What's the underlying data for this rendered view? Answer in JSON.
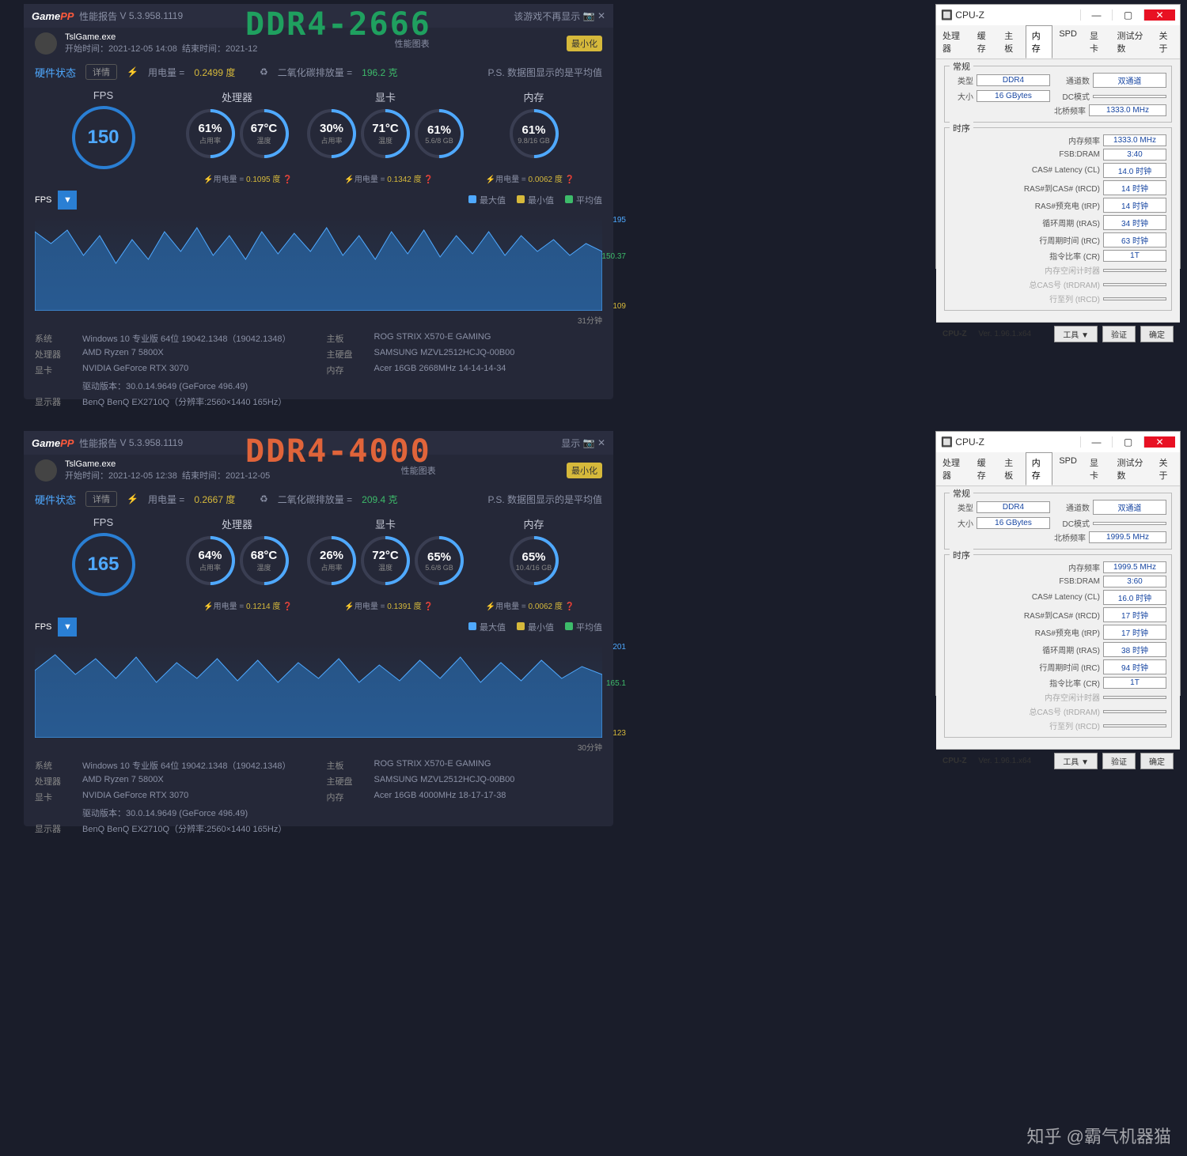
{
  "overlay": {
    "title1": "DDR4-2666",
    "title2": "DDR4-4000"
  },
  "watermark": "知乎 @霸气机器猫",
  "gamepp": {
    "brand": "Game",
    "brand2": "PP",
    "report": "性能报告",
    "version": "V 5.3.958.1119",
    "nodisp": "该游戏不再显示",
    "imgtab": "性能图表",
    "minbtn": "最小化",
    "exe": "TslGame.exe",
    "startlbl": "开始时间：",
    "endlbl": "结束时间：",
    "hw": "硬件状态",
    "detail": "详情",
    "pwrlbl": "用电量 =",
    "co2lbl": "二氧化碳排放量 =",
    "note": "P.S. 数据图显示的是平均值",
    "fps": "FPS",
    "cpu": "处理器",
    "gpu": "显卡",
    "mem": "内存",
    "usage": "占用率",
    "temp": "温度",
    "legend": {
      "max": "最大值",
      "min": "最小值",
      "avg": "平均值"
    },
    "spec": {
      "os": "系统",
      "cpu": "处理器",
      "gpu": "显卡",
      "drv": "驱动版本：",
      "mon": "显示器",
      "mb": "主板",
      "ssd": "主硬盘",
      "ram": "内存"
    }
  },
  "p1": {
    "start": "2021-12-05 14:08",
    "end": "2021-12",
    "pwr": "0.2499 度",
    "co2": "196.2 克",
    "fps": "150",
    "cpu_u": "61%",
    "cpu_t": "67°C",
    "gpu_u": "30%",
    "gpu_t": "71°C",
    "gpu_m": "5.6/8 GB",
    "mem_u": "61%",
    "mem_s": "9.8/16 GB",
    "pwr_cpu": "0.1095 度",
    "pwr_gpu": "0.1342 度",
    "pwr_mem": "0.0062 度",
    "chart": {
      "max": "195",
      "avg": "150.37",
      "min": "109",
      "dur": "31分钟"
    },
    "sys": {
      "os": "Windows 10 专业版 64位  19042.1348（19042.1348）",
      "cpu": "AMD Ryzen 7 5800X",
      "gpu": "NVIDIA GeForce RTX 3070",
      "drv": "30.0.14.9649 (GeForce 496.49)",
      "mon": "BenQ BenQ EX2710Q（分辨率:2560×1440 165Hz）",
      "mb": "ROG STRIX X570-E GAMING",
      "ssd": "SAMSUNG MZVL2512HCJQ-00B00",
      "ram": "Acer 16GB 2668MHz 14-14-14-34"
    }
  },
  "p2": {
    "start": "2021-12-05 12:38",
    "end": "2021-12-05",
    "pwr": "0.2667 度",
    "co2": "209.4 克",
    "fps": "165",
    "cpu_u": "64%",
    "cpu_t": "68°C",
    "gpu_u": "26%",
    "gpu_t": "72°C",
    "gpu_m": "5.6/8 GB",
    "mem_u": "65%",
    "mem_s": "10.4/16 GB",
    "pwr_cpu": "0.1214 度",
    "pwr_gpu": "0.1391 度",
    "pwr_mem": "0.0062 度",
    "chart": {
      "max": "201",
      "avg": "165.1",
      "min": "123",
      "dur": "30分钟"
    },
    "sys": {
      "os": "Windows 10 专业版 64位  19042.1348（19042.1348）",
      "cpu": "AMD Ryzen 7 5800X",
      "gpu": "NVIDIA GeForce RTX 3070",
      "drv": "30.0.14.9649 (GeForce 496.49)",
      "mon": "BenQ BenQ EX2710Q（分辨率:2560×1440 165Hz）",
      "mb": "ROG STRIX X570-E GAMING",
      "ssd": "SAMSUNG MZVL2512HCJQ-00B00",
      "ram": "Acer 16GB 4000MHz 18-17-17-38"
    }
  },
  "cpuz": {
    "title": "CPU-Z",
    "tabs": [
      "处理器",
      "缓存",
      "主板",
      "内存",
      "SPD",
      "显卡",
      "测试分数",
      "关于"
    ],
    "grp1": "常规",
    "grp2": "时序",
    "k": {
      "type": "类型",
      "size": "大小",
      "chan": "通道数",
      "dcmode": "DC模式",
      "nb": "北桥频率",
      "freq": "内存频率",
      "fsb": "FSB:DRAM",
      "cl": "CAS# Latency (CL)",
      "trcd": "RAS#到CAS# (tRCD)",
      "trp": "RAS#预充电 (tRP)",
      "tras": "循环周期 (tRAS)",
      "trc": "行周期时间 (tRC)",
      "cr": "指令比率 (CR)",
      "idle": "内存空闲计时器",
      "trdram": "总CAS号 (tRDRAM)",
      "trcdr": "行至列 (tRCD)"
    },
    "foot": {
      "ver": "Ver. 1.96.1.x64",
      "tool": "工具",
      "valid": "验证",
      "ok": "确定"
    }
  },
  "cz1": {
    "type": "DDR4",
    "size": "16 GBytes",
    "chan": "双通道",
    "nb": "1333.0 MHz",
    "freq": "1333.0 MHz",
    "fsb": "3:40",
    "cl": "14.0 时钟",
    "trcd": "14 时钟",
    "trp": "14 时钟",
    "tras": "34 时钟",
    "trc": "63 时钟",
    "cr": "1T"
  },
  "cz2": {
    "type": "DDR4",
    "size": "16 GBytes",
    "chan": "双通道",
    "nb": "1999.5 MHz",
    "freq": "1999.5 MHz",
    "fsb": "3:60",
    "cl": "16.0 时钟",
    "trcd": "17 时钟",
    "trp": "17 时钟",
    "tras": "38 时钟",
    "trc": "94 时钟",
    "cr": "1T"
  },
  "chart_data": [
    {
      "type": "line",
      "title": "FPS DDR4-2666",
      "ylim": [
        109,
        195
      ],
      "avg": 150.37,
      "duration_min": 31
    },
    {
      "type": "line",
      "title": "FPS DDR4-4000",
      "ylim": [
        123,
        201
      ],
      "avg": 165.1,
      "duration_min": 30
    }
  ]
}
